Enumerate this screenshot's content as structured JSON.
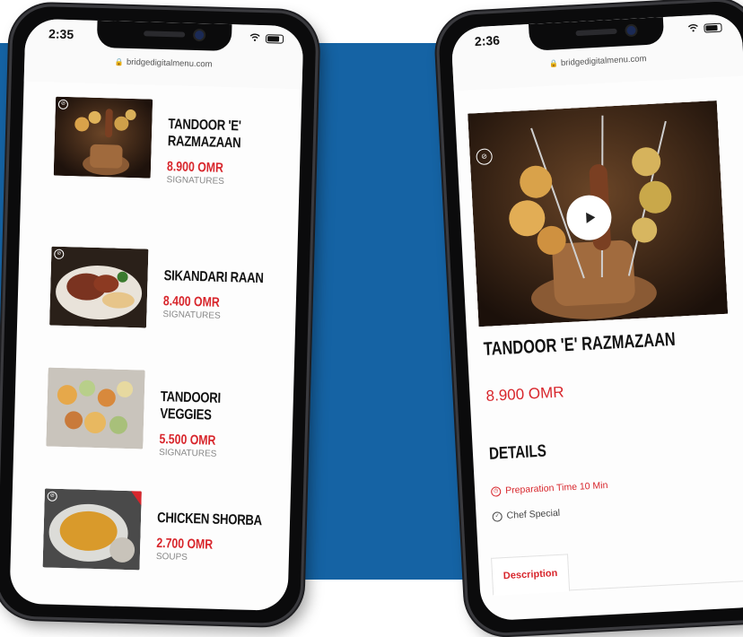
{
  "colors": {
    "background_blue": "#1563a4",
    "accent_red": "#d8262c",
    "text_dark": "#111111"
  },
  "left_phone": {
    "time": "2:35",
    "url": "bridgedigitalmenu.com",
    "items": [
      {
        "name": "TANDOOR 'E' RAZMAZAAN",
        "price": "8.900 OMR",
        "category": "SIGNATURES"
      },
      {
        "name": "SIKANDARI RAAN",
        "price": "8.400 OMR",
        "category": "SIGNATURES"
      },
      {
        "name": "TANDOORI VEGGIES",
        "price": "5.500 OMR",
        "category": "SIGNATURES"
      },
      {
        "name": "CHICKEN SHORBA",
        "price": "2.700 OMR",
        "category": "SOUPS"
      }
    ]
  },
  "right_phone": {
    "time": "2:36",
    "url": "bridgedigitalmenu.com",
    "title": "TANDOOR 'E' RAZMAZAAN",
    "price": "8.900 OMR",
    "details_heading": "DETAILS",
    "features": [
      {
        "icon": "clock-icon",
        "text": "Preparation Time 10 Min"
      },
      {
        "icon": "check-circle-icon",
        "text": "Chef Special"
      }
    ],
    "tab_label": "Description"
  }
}
